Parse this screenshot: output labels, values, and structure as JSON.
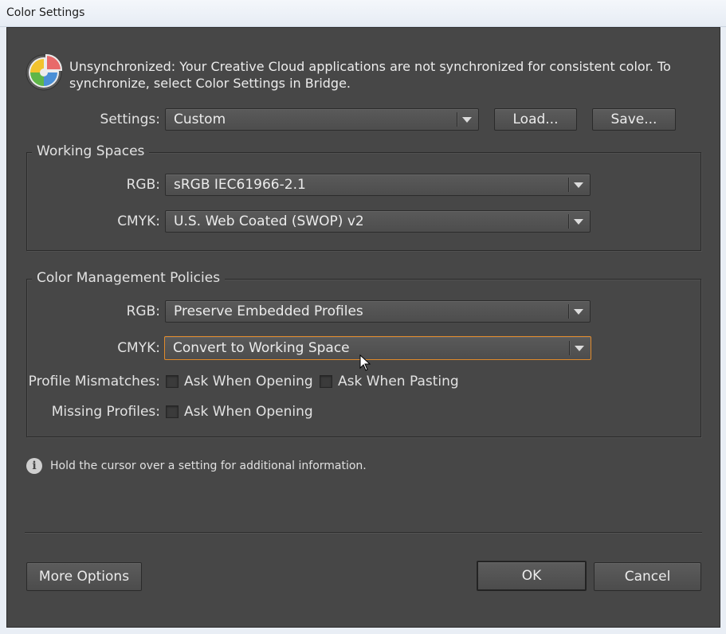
{
  "window": {
    "title": "Color Settings"
  },
  "sync": {
    "icon": "color-wheel-icon",
    "message": "Unsynchronized: Your Creative Cloud applications are not synchronized for consistent color. To synchronize, select Color Settings in Bridge."
  },
  "settings": {
    "label": "Settings:",
    "value": "Custom",
    "load_label": "Load...",
    "save_label": "Save..."
  },
  "working_spaces": {
    "title": "Working Spaces",
    "rgb_label": "RGB:",
    "rgb_value": "sRGB IEC61966-2.1",
    "cmyk_label": "CMYK:",
    "cmyk_value": "U.S. Web Coated (SWOP) v2"
  },
  "policies": {
    "title": "Color Management Policies",
    "rgb_label": "RGB:",
    "rgb_value": "Preserve Embedded Profiles",
    "cmyk_label": "CMYK:",
    "cmyk_value": "Convert to Working Space",
    "mismatch_label": "Profile Mismatches:",
    "mismatch_opening": "Ask When Opening",
    "mismatch_pasting": "Ask When Pasting",
    "missing_label": "Missing Profiles:",
    "missing_opening": "Ask When Opening"
  },
  "info": {
    "icon": "info-icon",
    "text": "Hold the cursor over a setting for additional information."
  },
  "footer": {
    "more_options_label": "More Options",
    "ok_label": "OK",
    "cancel_label": "Cancel"
  },
  "colors": {
    "dialog_bg": "#474747",
    "focus_accent": "#e08a2b"
  }
}
